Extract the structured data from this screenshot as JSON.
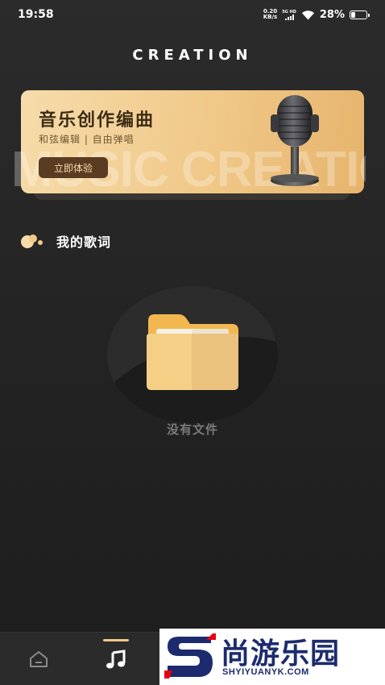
{
  "status_bar": {
    "time": "19:58",
    "net_speed_value": "0.20",
    "net_speed_unit": "KB/s",
    "network_label": "5G HD",
    "battery_percent": "28%",
    "battery_level": 0.28
  },
  "header": {
    "title": "CREATION"
  },
  "banner": {
    "title": "音乐创作编曲",
    "subtitle": "和弦编辑 | 自由弹唱",
    "button_label": "立即体验",
    "watermark_text": "MUSIC CREATION",
    "icon": "microphone-icon"
  },
  "section": {
    "title": "我的歌词",
    "icon": "bubbles-icon"
  },
  "empty_state": {
    "text": "没有文件",
    "icon": "folder-icon"
  },
  "tab_bar": {
    "tabs": [
      {
        "icon": "home-icon",
        "active": false
      },
      {
        "icon": "music-note-icon",
        "active": true
      }
    ]
  },
  "site_watermark": {
    "name": "尚游乐园",
    "url": "SHYIYUANYK.COM"
  },
  "colors": {
    "accent": "#f0c888",
    "banner_button": "#5a3c22",
    "logo_blue": "#1d2b6e",
    "logo_red": "#e60012"
  }
}
